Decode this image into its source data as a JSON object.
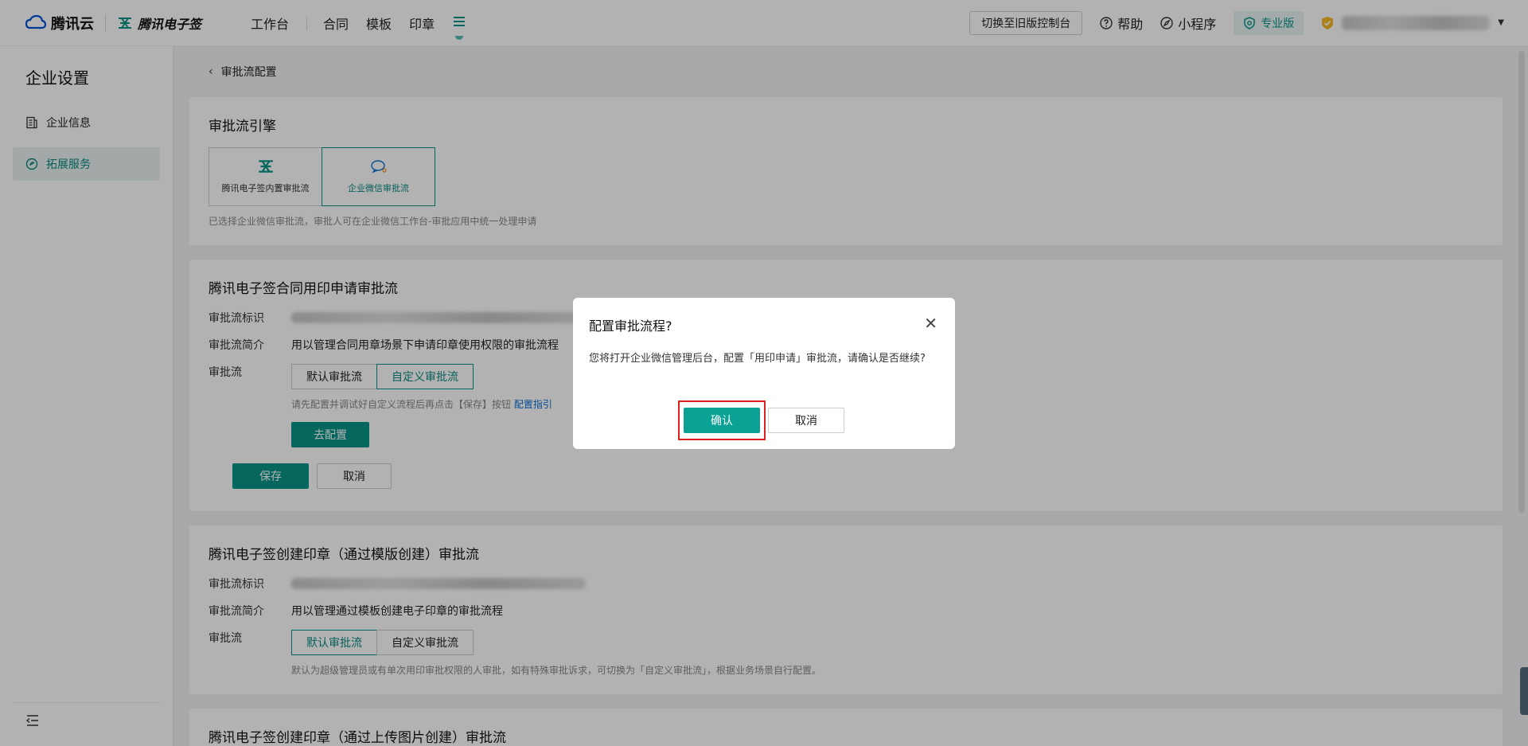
{
  "topbar": {
    "cloud_brand": "腾讯云",
    "esign_brand": "腾讯电子签",
    "nav": [
      "工作台",
      "合同",
      "模板",
      "印章"
    ],
    "old_console": "切换至旧版控制台",
    "help": "帮助",
    "miniprogram": "小程序",
    "edition": "专业版"
  },
  "sidebar": {
    "title": "企业设置",
    "items": [
      {
        "label": "企业信息"
      },
      {
        "label": "拓展服务"
      }
    ]
  },
  "main": {
    "breadcrumb": "审批流配置",
    "engine": {
      "title": "审批流引擎",
      "options": [
        "腾讯电子签内置审批流",
        "企业微信审批流"
      ],
      "hint": "已选择企业微信审批流，审批人可在企业微信工作台-审批应用中统一处理申请"
    },
    "section1": {
      "title": "腾讯电子签合同用印申请审批流",
      "id_label": "审批流标识",
      "desc_label": "审批流简介",
      "desc": "用以管理合同用章场景下申请印章使用权限的审批流程",
      "flow_label": "审批流",
      "flow_options": [
        "默认审批流",
        "自定义审批流"
      ],
      "hint": "请先配置并调试好自定义流程后再点击【保存】按钮",
      "guide_link": "配置指引",
      "config_btn": "去配置",
      "save_btn": "保存",
      "cancel_btn": "取消"
    },
    "section2": {
      "title": "腾讯电子签创建印章（通过模版创建）审批流",
      "id_label": "审批流标识",
      "desc_label": "审批流简介",
      "desc": "用以管理通过模板创建电子印章的审批流程",
      "flow_label": "审批流",
      "flow_options": [
        "默认审批流",
        "自定义审批流"
      ],
      "hint": "默认为超级管理员或有单次用印审批权限的人审批，如有特殊审批诉求，可切换为「自定义审批流」，根据业务场景自行配置。"
    },
    "section3": {
      "title": "腾讯电子签创建印章（通过上传图片创建）审批流"
    }
  },
  "dialog": {
    "title": "配置审批流程?",
    "body": "您将打开企业微信管理后台，配置「用印申请」审批流，请确认是否继续?",
    "confirm": "确认",
    "cancel": "取消"
  },
  "colors": {
    "accent": "#0a9488",
    "highlight": "#e02020"
  }
}
